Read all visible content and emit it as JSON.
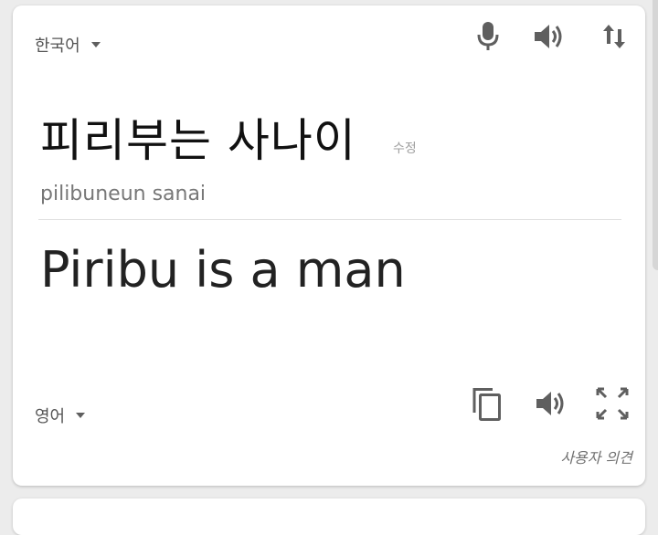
{
  "source": {
    "language": "한국어",
    "text": "피리부는 사나이",
    "edit_label": "수정",
    "romanization": "pilibuneun sanai"
  },
  "target": {
    "language": "영어",
    "text": "Piribu is a man"
  },
  "feedback_label": "사용자 의견",
  "icons": {
    "microphone": "microphone-icon",
    "speaker": "speaker-icon",
    "swap": "swap-languages-icon",
    "copy": "copy-icon",
    "fullscreen": "fullscreen-icon",
    "dropdown": "chevron-down-icon"
  },
  "colors": {
    "card_background": "#ffffff",
    "page_background": "#ececec",
    "icon": "#5f5f5f",
    "muted_text": "#777777"
  }
}
